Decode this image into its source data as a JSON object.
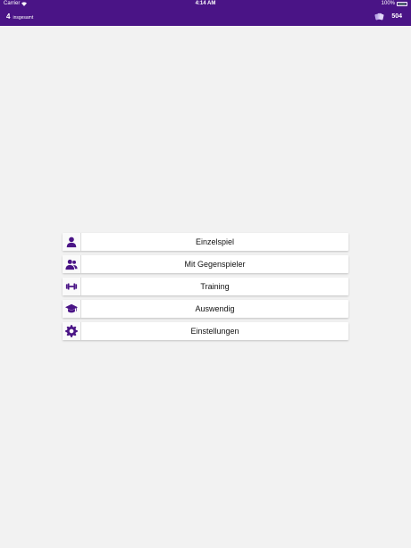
{
  "statusbar": {
    "carrier": "Carrier",
    "time": "4:14 AM",
    "battery": "100%"
  },
  "navbar": {
    "count": "4",
    "count_label": "insgesamt",
    "score": "504"
  },
  "menu": {
    "items": [
      {
        "label": "Einzelspiel",
        "icon": "person-icon"
      },
      {
        "label": "Mit Gegenspieler",
        "icon": "people-icon"
      },
      {
        "label": "Training",
        "icon": "dumbbell-icon"
      },
      {
        "label": "Auswendig",
        "icon": "graduation-cap-icon"
      },
      {
        "label": "Einstellungen",
        "icon": "gear-icon"
      }
    ]
  },
  "colors": {
    "primary": "#4a1486",
    "background": "#f2f2f2"
  }
}
